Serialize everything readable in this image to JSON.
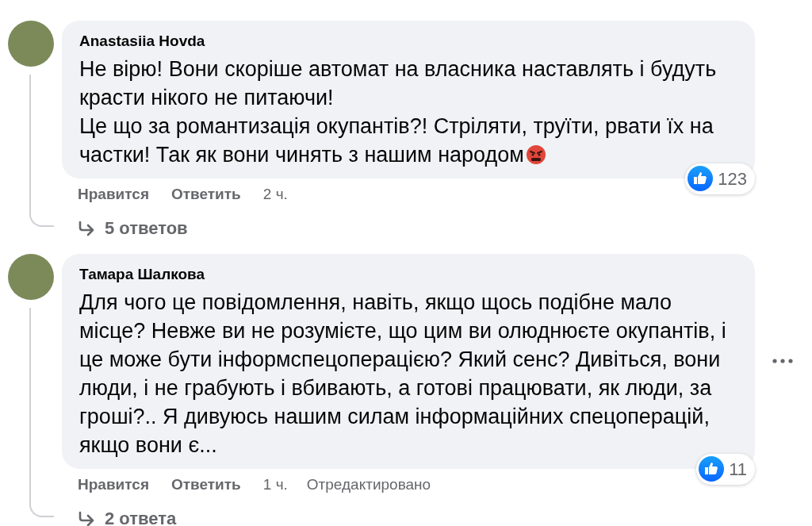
{
  "comments": [
    {
      "author": "Anastasiia Hovda",
      "paragraphs": [
        "Не вірю! Вони скоріше автомат на власника наставлять і будуть красти нікого не питаючи!",
        "Це що за романтизація окупантів?! Стріляти, труїти, рвати їх на частки! Так як вони чинять з нашим народом"
      ],
      "ends_with_angry_emoji": true,
      "reactions": "123",
      "actions": [
        "Нравится",
        "Ответить"
      ],
      "time": "2 ч.",
      "more_button": false,
      "replies": "5 ответов"
    },
    {
      "author": "Тамара Шалкова",
      "paragraphs": [
        "Для чого це повідомлення, навіть, якщо щось подібне мало місце? Невже ви не розумієте, що цим ви олюднюєте окупантів, і це може бути інформспецоперацією? Який сенс? Дивіться, вони люди, і не грабують і вбивають, а готові працювати, як люди, за гроші?.. Я дивуюсь нашим силам інформаційних спецоперацій, якщо вони є..."
      ],
      "ends_with_angry_emoji": false,
      "reactions": "11",
      "actions": [
        "Нравится",
        "Ответить"
      ],
      "time": "1 ч.",
      "edited_label": "Отредактировано",
      "more_button": true,
      "replies": "2 ответа"
    }
  ]
}
